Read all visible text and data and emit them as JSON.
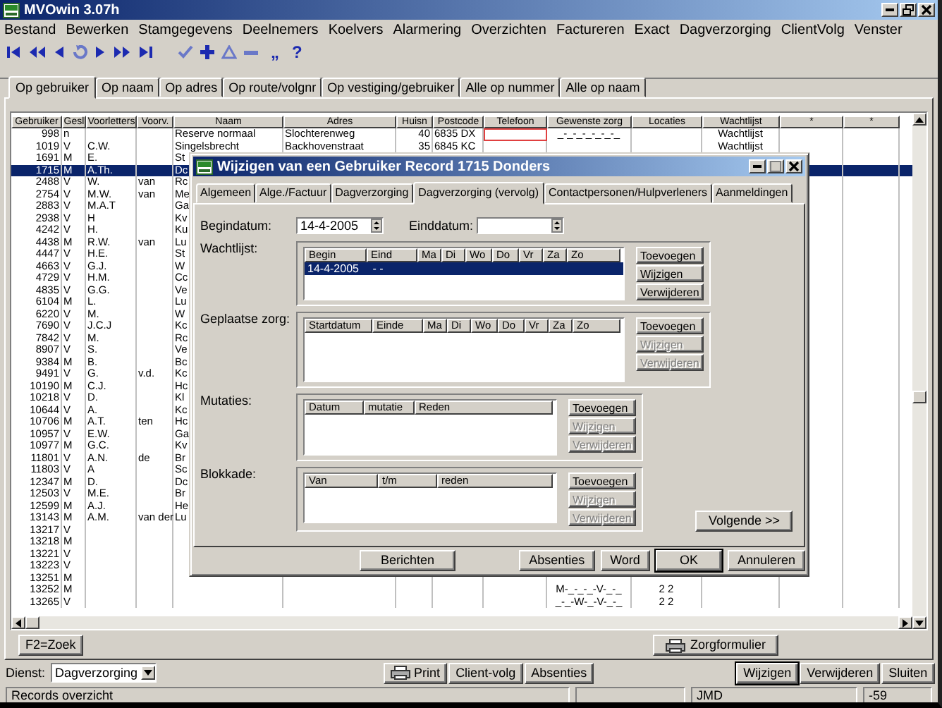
{
  "window": {
    "title": "MVOwin 3.07h"
  },
  "menu": [
    "Bestand",
    "Bewerken",
    "Stamgegevens",
    "Deelnemers",
    "Koelvers",
    "Alarmering",
    "Overzichten",
    "Factureren",
    "Exact",
    "Dagverzorging",
    "ClientVolg",
    "Venster"
  ],
  "toolbar": [
    {
      "kind": "first"
    },
    {
      "kind": "rewind"
    },
    {
      "kind": "prev"
    },
    {
      "kind": "refresh"
    },
    {
      "kind": "next"
    },
    {
      "kind": "forward"
    },
    {
      "kind": "last"
    },
    {
      "kind": "check"
    },
    {
      "kind": "plus"
    },
    {
      "kind": "delta"
    },
    {
      "kind": "minus"
    },
    {
      "kind": "glyph",
      "text": "„"
    },
    {
      "kind": "glyph",
      "text": "?"
    }
  ],
  "tabs": [
    {
      "label": "Op gebruiker",
      "selected": true
    },
    {
      "label": "Op naam",
      "selected": false
    },
    {
      "label": "Op adres",
      "selected": false
    },
    {
      "label": "Op route/volgnr",
      "selected": false
    },
    {
      "label": "Op vestiging/gebruiker",
      "selected": false
    },
    {
      "label": "Alle op nummer",
      "selected": false
    },
    {
      "label": "Alle op naam",
      "selected": false
    }
  ],
  "table": {
    "columns": [
      "Gebruiker",
      "Gesl",
      "Voorletters",
      "Voorv.",
      "Naam",
      "Adres",
      "Huisn",
      "Postcode",
      "Telefoon",
      "Gewenste zorg",
      "Locaties",
      "Wachtlijst",
      "*",
      "*"
    ],
    "rows": [
      {
        "gebruiker": "998",
        "gesl": "n",
        "naam": "Reserve normaal",
        "adres": "Slochterenweg",
        "huisnr": "40",
        "postcode": "6835 DX",
        "zorg": "_-_-_-_-_-_-_",
        "wachtlijst": "Wachtlijst",
        "focused": true,
        "selected": false
      },
      {
        "gebruiker": "1019",
        "gesl": "V",
        "voorletters": "C.W.",
        "naam": "Singelsbrecht",
        "adres": "Backhovenstraat",
        "huisnr": "35",
        "postcode": "6845 KC",
        "wachtlijst": "Wachtlijst",
        "selected": false
      },
      {
        "gebruiker": "1691",
        "gesl": "M",
        "voorletters": "E.",
        "naam": "St",
        "selected": false
      },
      {
        "gebruiker": "1715",
        "gesl": "M",
        "voorletters": "A.Th.",
        "naam": "Dc",
        "selected": true
      },
      {
        "gebruiker": "2488",
        "gesl": "V",
        "voorletters": "W.",
        "voorv": "van",
        "naam": "Rc",
        "selected": false
      },
      {
        "gebruiker": "2754",
        "gesl": "V",
        "voorletters": "M.W.",
        "voorv": "van",
        "naam": "Me",
        "selected": false
      },
      {
        "gebruiker": "2883",
        "gesl": "V",
        "voorletters": "M.A.T",
        "naam": "Ga",
        "selected": false
      },
      {
        "gebruiker": "2938",
        "gesl": "V",
        "voorletters": "H",
        "naam": "Kv",
        "selected": false
      },
      {
        "gebruiker": "4242",
        "gesl": "V",
        "voorletters": "H.",
        "naam": "Ku",
        "selected": false
      },
      {
        "gebruiker": "4438",
        "gesl": "M",
        "voorletters": "R.W.",
        "voorv": "van",
        "naam": "Lu",
        "selected": false
      },
      {
        "gebruiker": "4447",
        "gesl": "V",
        "voorletters": "H.E.",
        "naam": "St",
        "selected": false
      },
      {
        "gebruiker": "4663",
        "gesl": "V",
        "voorletters": "G.J.",
        "naam": "W",
        "selected": false
      },
      {
        "gebruiker": "4729",
        "gesl": "V",
        "voorletters": "H.M.",
        "naam": "Cc",
        "selected": false
      },
      {
        "gebruiker": "4835",
        "gesl": "V",
        "voorletters": "G.G.",
        "naam": "Ve",
        "selected": false
      },
      {
        "gebruiker": "6104",
        "gesl": "M",
        "voorletters": "L.",
        "naam": "Lu",
        "selected": false
      },
      {
        "gebruiker": "6220",
        "gesl": "V",
        "voorletters": "M.",
        "naam": "W",
        "selected": false
      },
      {
        "gebruiker": "7690",
        "gesl": "V",
        "voorletters": "J.C.J",
        "naam": "Kc",
        "selected": false
      },
      {
        "gebruiker": "7842",
        "gesl": "V",
        "voorletters": "M.",
        "naam": "Rc",
        "selected": false
      },
      {
        "gebruiker": "8907",
        "gesl": "V",
        "voorletters": "S.",
        "naam": "Ve",
        "selected": false
      },
      {
        "gebruiker": "9384",
        "gesl": "M",
        "voorletters": "B.",
        "naam": "Bc",
        "selected": false
      },
      {
        "gebruiker": "9491",
        "gesl": "V",
        "voorletters": "G.",
        "voorv": "v.d.",
        "naam": "Kc",
        "selected": false
      },
      {
        "gebruiker": "10190",
        "gesl": "M",
        "voorletters": "C.J.",
        "naam": "Hc",
        "selected": false
      },
      {
        "gebruiker": "10218",
        "gesl": "V",
        "voorletters": "D.",
        "naam": "Kl",
        "selected": false
      },
      {
        "gebruiker": "10644",
        "gesl": "V",
        "voorletters": "A.",
        "naam": "Kc",
        "selected": false
      },
      {
        "gebruiker": "10706",
        "gesl": "M",
        "voorletters": "A.T.",
        "voorv": "ten",
        "naam": "Hc",
        "selected": false
      },
      {
        "gebruiker": "10957",
        "gesl": "V",
        "voorletters": "E.W.",
        "naam": "Ga",
        "selected": false
      },
      {
        "gebruiker": "10977",
        "gesl": "M",
        "voorletters": "G.C.",
        "naam": "Kv",
        "selected": false
      },
      {
        "gebruiker": "11801",
        "gesl": "V",
        "voorletters": "A.N.",
        "voorv": "de",
        "naam": "Br",
        "selected": false
      },
      {
        "gebruiker": "11803",
        "gesl": "V",
        "voorletters": "A",
        "naam": "Sc",
        "selected": false
      },
      {
        "gebruiker": "12347",
        "gesl": "M",
        "voorletters": "D.",
        "naam": "Dc",
        "selected": false
      },
      {
        "gebruiker": "12503",
        "gesl": "V",
        "voorletters": "M.E.",
        "naam": "Br",
        "selected": false
      },
      {
        "gebruiker": "12599",
        "gesl": "M",
        "voorletters": "A.J.",
        "naam": "He",
        "selected": false
      },
      {
        "gebruiker": "13143",
        "gesl": "M",
        "voorletters": "A.M.",
        "voorv": "van der",
        "naam": "Lu",
        "selected": false
      },
      {
        "gebruiker": "13217",
        "gesl": "V",
        "selected": false
      },
      {
        "gebruiker": "13218",
        "gesl": "M",
        "selected": false
      },
      {
        "gebruiker": "13221",
        "gesl": "V",
        "selected": false
      },
      {
        "gebruiker": "13223",
        "gesl": "V",
        "selected": false
      },
      {
        "gebruiker": "13251",
        "gesl": "M",
        "selected": false
      },
      {
        "gebruiker": "13252",
        "gesl": "M",
        "zorg": "M-_-_-_-V-_-_",
        "locaties": "2 2",
        "selected": false
      },
      {
        "gebruiker": "13265",
        "gesl": "V",
        "zorg": "_-_-W-_-V-_-_",
        "locaties": "2 2",
        "selected": false
      }
    ]
  },
  "search_button": "F2=Zoek",
  "form_button": "Zorgformulier",
  "dienst": {
    "label": "Dienst:",
    "value": "Dagverzorging"
  },
  "actions": [
    {
      "label": "Print",
      "kind": "print",
      "default": false
    },
    {
      "label": "Client-volg",
      "kind": "plain",
      "default": false
    },
    {
      "label": "Absenties",
      "kind": "spaced",
      "default": false
    },
    {
      "label": "Wijzigen",
      "kind": "spaced",
      "default": true
    },
    {
      "label": "Verwijderen",
      "kind": "plain",
      "default": false
    },
    {
      "label": "Sluiten",
      "kind": "plain",
      "default": false
    }
  ],
  "status_bar": {
    "message": "Records overzicht",
    "user": "JMD",
    "value": "-59"
  },
  "dialog": {
    "title": "Wijzigen van een Gebruiker Record 1715 Donders",
    "tabs": [
      {
        "label": "Algemeen",
        "selected": false
      },
      {
        "label": "Alge./Factuur",
        "selected": false
      },
      {
        "label": "Dagverzorging",
        "selected": false
      },
      {
        "label": "Dagverzorging (vervolg)",
        "selected": true
      },
      {
        "label": "Contactpersonen/Hulpverleners",
        "selected": false
      },
      {
        "label": "Aanmeldingen",
        "selected": false
      }
    ],
    "begindatum": {
      "label": "Begindatum:",
      "value": "14-4-2005"
    },
    "einddatum": {
      "label": "Einddatum:"
    },
    "sections": [
      {
        "label": "Wachtlijst:",
        "columns": [
          "Begin",
          "Eind",
          "Ma",
          "Di",
          "Wo",
          "Do",
          "Vr",
          "Za",
          "Zo"
        ],
        "rows": [
          {
            "cells": [
              "14-4-2005",
              " - -"
            ],
            "selected": true
          }
        ],
        "buttons": [
          {
            "label": "Toevoegen",
            "disabled": false
          },
          {
            "label": "Wijzigen",
            "disabled": false
          },
          {
            "label": "Verwijderen",
            "disabled": false
          }
        ]
      },
      {
        "label": "Geplaatse zorg:",
        "columns": [
          "Startdatum",
          "Einde",
          "Ma",
          "Di",
          "Wo",
          "Do",
          "Vr",
          "Za",
          "Zo"
        ],
        "buttons": [
          {
            "label": "Toevoegen",
            "disabled": false
          },
          {
            "label": "Wijzigen",
            "disabled": true
          },
          {
            "label": "Verwijderen",
            "disabled": true
          }
        ]
      },
      {
        "label": "Mutaties:",
        "columns": [
          "Datum",
          "mutatie",
          "Reden"
        ],
        "buttons": [
          {
            "label": "Toevoegen",
            "disabled": false
          },
          {
            "label": "Wijzigen",
            "disabled": true
          },
          {
            "label": "Verwijderen",
            "disabled": true
          }
        ]
      },
      {
        "label": "Blokkade:",
        "columns": [
          "Van",
          "t/m",
          "reden"
        ],
        "buttons": [
          {
            "label": "Toevoegen",
            "disabled": false
          },
          {
            "label": "Wijzigen",
            "disabled": true
          },
          {
            "label": "Verwijderen",
            "disabled": true
          }
        ]
      }
    ],
    "next_button": "Volgende >>",
    "messages_button": "Berichten",
    "buttons": [
      {
        "label": "Absenties",
        "default": false
      },
      {
        "label": "Word",
        "default": false
      },
      {
        "label": "OK",
        "default": true
      },
      {
        "label": "Annuleren",
        "default": false
      }
    ]
  }
}
